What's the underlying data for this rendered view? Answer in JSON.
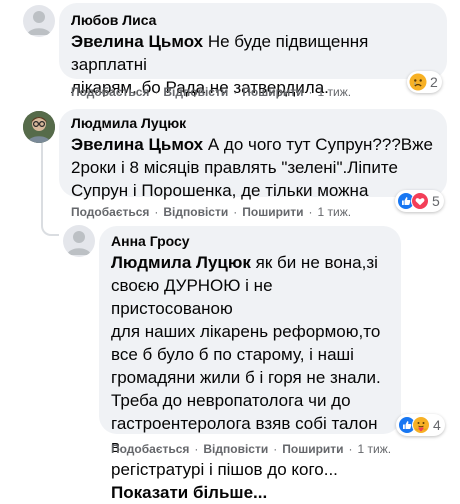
{
  "actions": {
    "like": "Подобається",
    "reply": "Відповісти",
    "share": "Поширити",
    "separator": "·"
  },
  "comments": [
    {
      "author": "Любов Лиса",
      "mention": "Эвелина Цьмох",
      "text_line1": " Не буде підвищення зарплатні",
      "text_line2": "лікарям, бо Рада не затвердила.",
      "time": "1 тиж.",
      "reactions": [
        "sad"
      ],
      "reaction_count": "2"
    },
    {
      "author": "Людмила Луцюк",
      "mention": "Эвелина Цьмох",
      "text_line1": " А до чого тут Супрун???Вже",
      "text_line2": "2роки і 8 місяців правлять \"зелені\".Ліпите",
      "text_line3": "Супрун і Порошенка, де тільки можна",
      "time": "1 тиж.",
      "reactions": [
        "like",
        "love"
      ],
      "reaction_count": "5"
    },
    {
      "author": "Анна Гросу",
      "mention": "Людмила Луцюк",
      "text_line1": " як би не вона,зі",
      "text_line2": "своєю ДУРНОЮ і не пристосованою",
      "text_line3": "для наших лікарень реформою,то",
      "text_line4": "все б було б по старому, і наші",
      "text_line5": "громадяни жили б і горя не знали.",
      "text_line6": "Треба до невропатолога чи до",
      "text_line7": "гастроентеролога взяв собі талон в",
      "text_line8": "регістратурі і пішов до кого...",
      "see_more": "Показати більше...",
      "time": "1 тиж.",
      "reactions": [
        "like",
        "care"
      ],
      "reaction_count": "4"
    }
  ],
  "colors": {
    "bubble": "#f0f2f5",
    "meta": "#65676b",
    "like": "#1877f2",
    "love": "#f33e58",
    "reaction_yellow": "#f7b125"
  }
}
